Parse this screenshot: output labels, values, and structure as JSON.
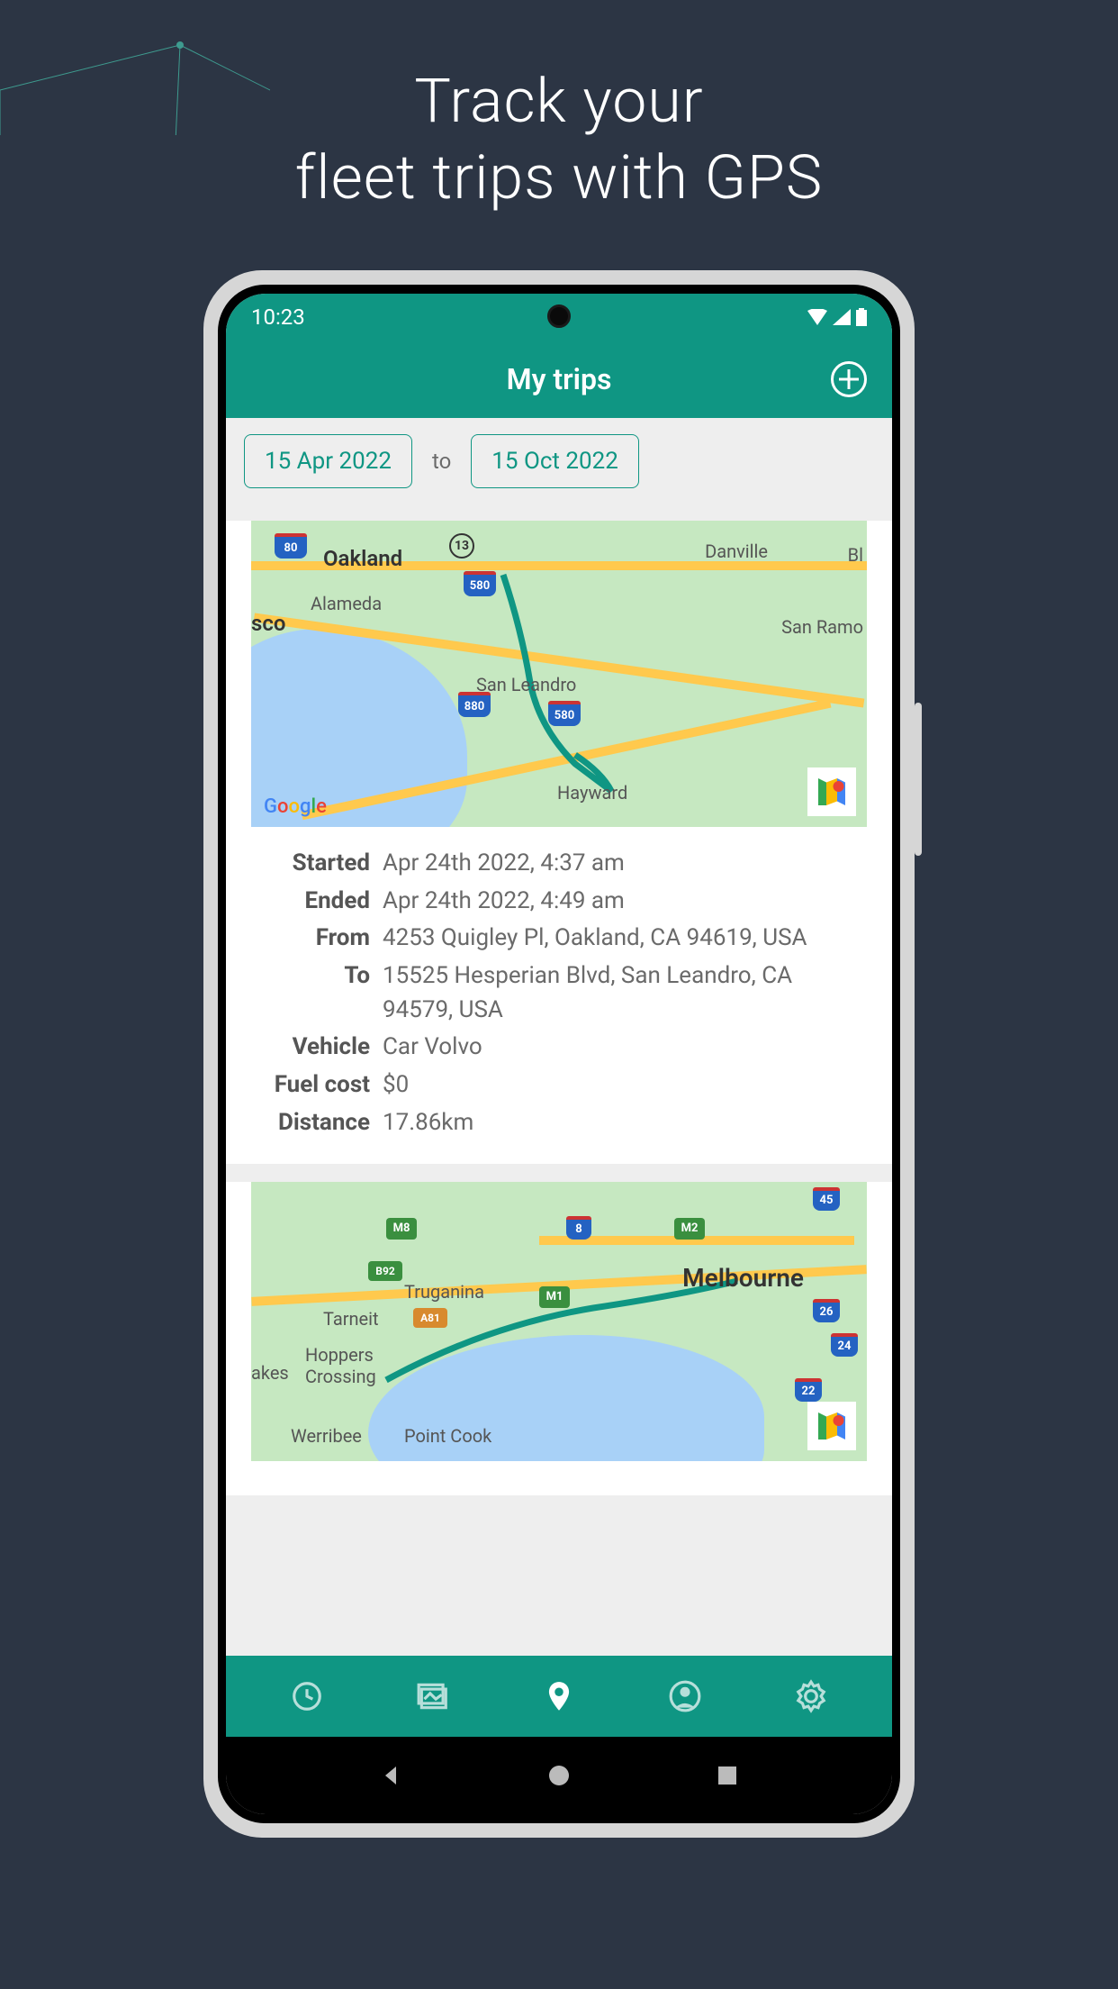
{
  "headline_l1": "Track your",
  "headline_l2": "fleet trips with GPS",
  "status_time": "10:23",
  "app_title": "My trips",
  "filter": {
    "from_date": "15 Apr 2022",
    "to_label": "to",
    "to_date": "15 Oct 2022"
  },
  "labels": {
    "started": "Started",
    "ended": "Ended",
    "from": "From",
    "to": "To",
    "vehicle": "Vehicle",
    "fuel_cost": "Fuel cost",
    "distance": "Distance"
  },
  "trips": [
    {
      "started": "Apr 24th 2022, 4:37 am",
      "ended": "Apr 24th 2022, 4:49 am",
      "from": "4253 Quigley Pl, Oakland, CA 94619, USA",
      "to": "15525 Hesperian Blvd, San Leandro, CA 94579, USA",
      "vehicle": "Car Volvo",
      "fuel_cost": "$0",
      "distance": "17.86km",
      "map_places": {
        "oakland": "Oakland",
        "alameda": "Alameda",
        "san_leandro": "San Leandro",
        "hayward": "Hayward",
        "danville": "Danville",
        "san_ramon": "San Ramo",
        "sf": "sco",
        "bl": "Bl"
      },
      "shields": {
        "i80": "80",
        "r13": "13",
        "i580": "580",
        "i880": "880",
        "i580b": "580"
      }
    },
    {
      "map_places": {
        "melbourne": "Melbourne",
        "truganina": "Truganina",
        "tarneit": "Tarneit",
        "hoppers": "Hoppers",
        "crossing": "Crossing",
        "werribee": "Werribee",
        "point_cook": "Point Cook",
        "lakes": "akes"
      },
      "shields": {
        "m8": "M8",
        "m2": "M2",
        "b92": "B92",
        "m1": "M1",
        "a81": "A81",
        "r8": "8",
        "r45": "45",
        "r26": "26",
        "r24": "24",
        "r22": "22"
      }
    }
  ],
  "google_logo": "Google"
}
